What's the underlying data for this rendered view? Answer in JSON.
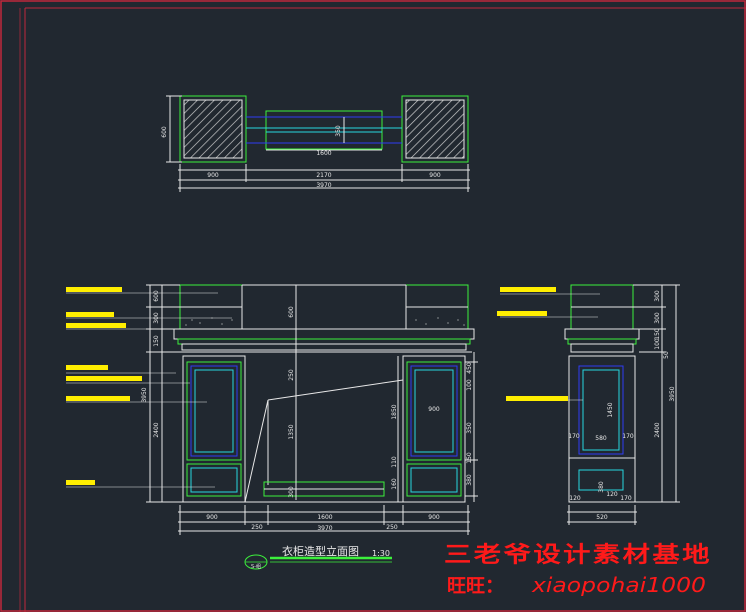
{
  "drawing": {
    "colors": {
      "background": "#212830",
      "line": "#e8e8e8",
      "green": "#3cf03c",
      "cyan": "#26d7e0",
      "blue": "#2f3cf5",
      "yellow": "#ffee00",
      "red": "#ff1a1a",
      "frame_red": "#c0283c"
    },
    "title": {
      "text": "衣柜造型立面图",
      "scale": "1:30",
      "tag": "S-组"
    },
    "plan_dims": {
      "depth": "600",
      "left": "900",
      "middle": "2170",
      "right": "900",
      "total": "3970",
      "inner_width": "1600",
      "inner_depth": "350"
    },
    "front_dims": {
      "bottom_left": "900",
      "bottom_gap_left": "250",
      "bottom_mid": "1600",
      "bottom_gap_right": "250",
      "bottom_right": "900",
      "bottom_total": "3970",
      "left_stack": [
        "600",
        "300",
        "150",
        "2400",
        "3950"
      ],
      "mid_heights": [
        "600",
        "250",
        "1350",
        "300"
      ],
      "right_stack": [
        "450",
        "100",
        "1850",
        "350",
        "150",
        "380",
        "110",
        "160"
      ],
      "shelf_width": "900"
    },
    "side_dims": {
      "width": "520",
      "bottom_split": [
        "120",
        "170"
      ],
      "inner": [
        "170",
        "580",
        "170"
      ],
      "height_main": "1450",
      "height_total": "3950",
      "height_lower": "2400",
      "right_stack": [
        "300",
        "300",
        "150",
        "100",
        "50"
      ],
      "bottom_parts": [
        "380",
        "120"
      ]
    },
    "icon": "dimensioned-cad-elevation-drawing"
  },
  "watermark": {
    "line1": "三老爷设计素材基地",
    "line2_label": "旺旺：",
    "line2_handle": "xiaopohai1000"
  }
}
